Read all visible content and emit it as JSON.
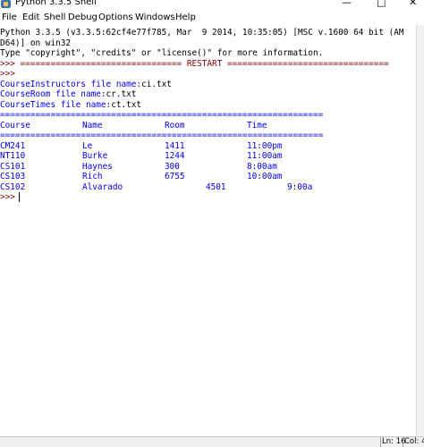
{
  "window": {
    "title": "Python 3.3.5 Shell",
    "minimize": "—",
    "maximize": "□",
    "close": "✕"
  },
  "menu": [
    "File",
    "Edit",
    "Shell",
    "Debug",
    "Options",
    "Windows",
    "Help"
  ],
  "shell": {
    "banner": [
      "Python 3.3.5 (v3.3.5:62cf4e77f785, Mar  9 2014, 10:35:05) [MSC v.1600 64 bit (AM",
      "D64)] on win32",
      "Type \"copyright\", \"credits\" or \"license()\" for more information."
    ],
    "restart_line": ">>> ================================ RESTART ================================",
    "prompt": ">>>",
    "inputs": [
      {
        "label": "CourseInstructors file name:",
        "value": "ci.txt"
      },
      {
        "label": "CourseRoom file name:",
        "value": "cr.txt"
      },
      {
        "label": "CourseTimes file name:",
        "value": "ct.txt"
      }
    ],
    "separator": "================================================================",
    "headers": [
      "Course",
      "Name",
      "Room",
      "Time"
    ],
    "rows": [
      [
        "CM241",
        "Le",
        "1411",
        "11:00pm"
      ],
      [
        "NT110",
        "Burke",
        "1244",
        "11:00am"
      ],
      [
        "CS101",
        "Haynes",
        "300",
        "8:00am"
      ],
      [
        "CS103",
        "Rich",
        "6755",
        "10:00am"
      ],
      [
        "CS102",
        "Alvarado",
        "4501",
        "9:00a"
      ]
    ],
    "final_prompt": ">>>"
  },
  "status": {
    "line": "Ln: 16",
    "col": "Col: 4"
  },
  "colors": {
    "output_blue": "#0000e6",
    "prompt_maroon": "#7f0000"
  },
  "icons": [
    "python-idle-icon"
  ]
}
